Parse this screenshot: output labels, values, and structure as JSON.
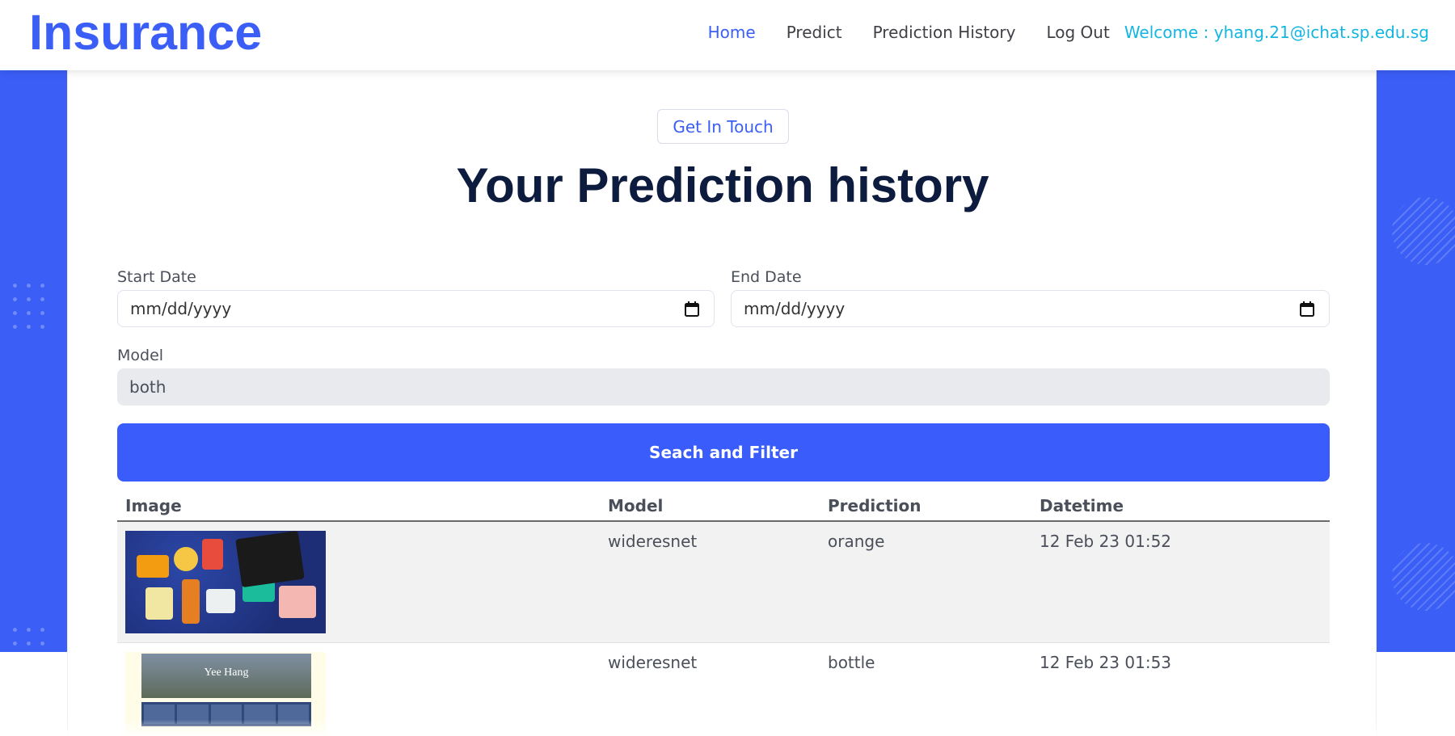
{
  "header": {
    "brand": "Insurance",
    "nav": [
      {
        "label": "Home",
        "active": true
      },
      {
        "label": "Predict",
        "active": false
      },
      {
        "label": "Prediction History",
        "active": false
      },
      {
        "label": "Log Out",
        "active": false
      }
    ],
    "welcome": "Welcome : yhang.21@ichat.sp.edu.sg"
  },
  "hero": {
    "pill": "Get In Touch",
    "title": "Your Prediction history"
  },
  "filters": {
    "start_label": "Start Date",
    "start_value": "mm/dd/yyyy",
    "end_label": "End Date",
    "end_value": "mm/dd/yyyy",
    "model_label": "Model",
    "model_value": "both",
    "search_button": "Seach and Filter"
  },
  "table": {
    "headers": [
      "Image",
      "Model",
      "Prediction",
      "Datetime"
    ],
    "rows": [
      {
        "image": "snack-box-photo",
        "model": "wideresnet",
        "prediction": "orange",
        "datetime": "12 Feb 23 01:52"
      },
      {
        "image": "website-screenshot",
        "model": "wideresnet",
        "prediction": "bottle",
        "datetime": "12 Feb 23 01:53",
        "thumb_title": "Yee Hang"
      }
    ]
  },
  "colors": {
    "accent": "#3b5ef7",
    "welcome": "#12b6e0",
    "title": "#0d1b3e"
  }
}
